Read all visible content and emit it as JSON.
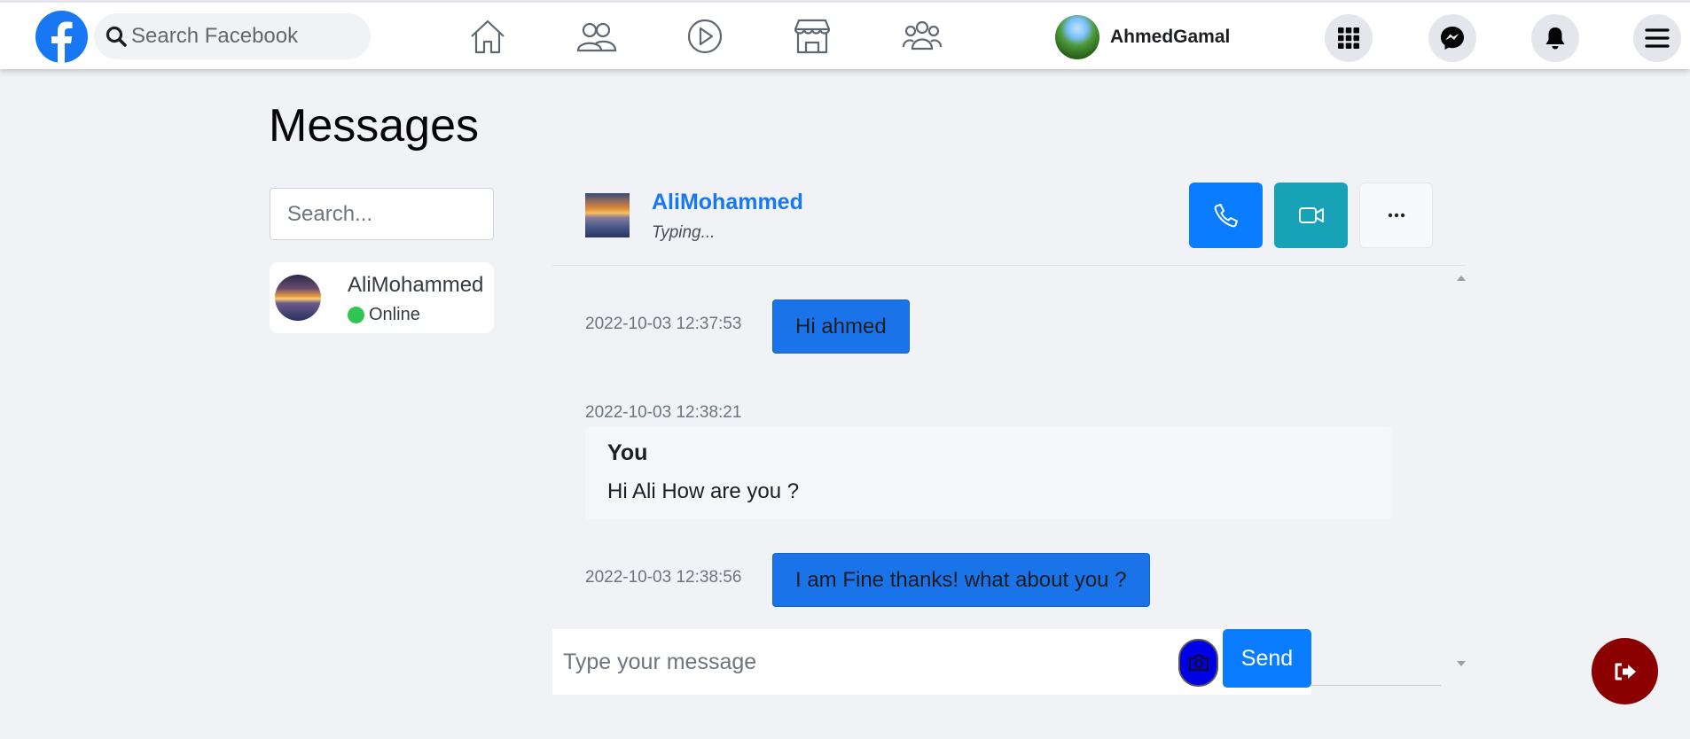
{
  "app": {
    "search_placeholder": "Search Facebook",
    "brand_color": "#1877f2"
  },
  "nav": {
    "icons": [
      "home-icon",
      "friends-icon",
      "watch-icon",
      "marketplace-icon",
      "groups-icon"
    ],
    "profile_name": "AhmedGamal",
    "right_icons": [
      "menu-grid-icon",
      "messenger-icon",
      "bell-icon",
      "hamburger-icon"
    ]
  },
  "page": {
    "title": "Messages"
  },
  "sidebar": {
    "search_placeholder": "Search...",
    "contacts": [
      {
        "name": "AliMohammed",
        "status": "Online",
        "status_color": "#31c552"
      }
    ]
  },
  "chat": {
    "contact_name": "AliMohammed",
    "status": "Typing...",
    "actions": [
      "phone-icon",
      "video-icon",
      "more-icon"
    ],
    "messages": [
      {
        "timestamp": "2022-10-03 12:37:53",
        "text": "Hi ahmed"
      },
      {
        "timestamp": "2022-10-03 12:38:21",
        "sender": "You",
        "text": "Hi Ali How are you ?"
      },
      {
        "timestamp": "2022-10-03 12:38:56",
        "text": "I am Fine thanks! what about you ?"
      }
    ],
    "compose_placeholder": "Type your message",
    "send_label": "Send"
  },
  "colors": {
    "background": "#f0f2f5",
    "accent_blue": "#0a7cff",
    "video_teal": "#17a2b8",
    "logout_red": "#8b0000",
    "camera_blue": "#0000e6"
  }
}
